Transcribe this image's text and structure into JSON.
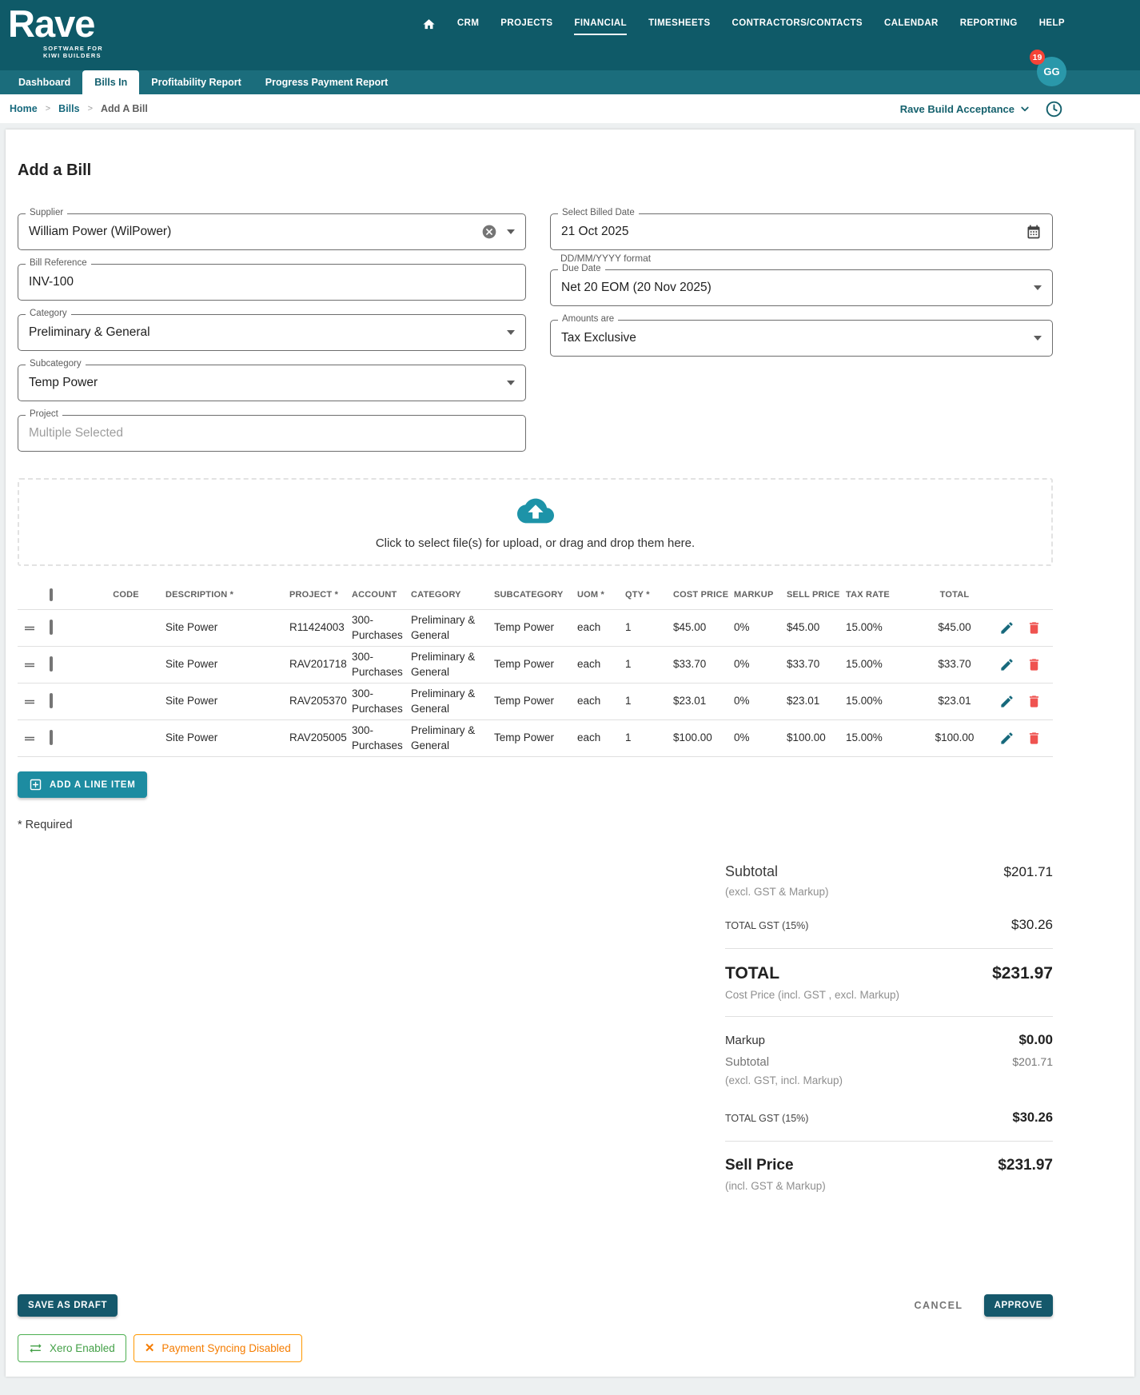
{
  "colors": {
    "header_teal": "#0f5a68",
    "tabrow_teal": "#1b6d7c",
    "accent_teal": "#15616d",
    "bright_teal": "#1d8ca1",
    "button_teal": "#15586b",
    "badge_red": "#f44336",
    "delete_red": "#ef5350",
    "xero_green": "#43a047",
    "warn_orange": "#f57c00"
  },
  "header": {
    "logo_title": "Rave",
    "logo_subtitle_1": "SOFTWARE FOR",
    "logo_subtitle_2": "KIWI BUILDERS",
    "nav": [
      {
        "label": "CRM"
      },
      {
        "label": "PROJECTS"
      },
      {
        "label": "FINANCIAL",
        "active": true
      },
      {
        "label": "TIMESHEETS"
      },
      {
        "label": "CONTRACTORS/CONTACTS"
      },
      {
        "label": "CALENDAR"
      },
      {
        "label": "REPORTING"
      },
      {
        "label": "HELP"
      }
    ],
    "notification_count": "19",
    "avatar_initials": "GG"
  },
  "tabs": [
    {
      "label": "Dashboard"
    },
    {
      "label": "Bills In",
      "active": true
    },
    {
      "label": "Profitability Report"
    },
    {
      "label": "Progress Payment Report"
    }
  ],
  "breadcrumb": {
    "home": "Home",
    "bills": "Bills",
    "current": "Add A Bill"
  },
  "context_bar": {
    "selector_label": "Rave Build Acceptance"
  },
  "page_title": "Add a Bill",
  "form": {
    "supplier": {
      "label": "Supplier",
      "value": "William Power (WilPower)"
    },
    "bill_reference": {
      "label": "Bill Reference",
      "value": "INV-100"
    },
    "category": {
      "label": "Category",
      "value": "Preliminary & General"
    },
    "subcategory": {
      "label": "Subcategory",
      "value": "Temp Power"
    },
    "project": {
      "label": "Project",
      "value": "Multiple Selected"
    },
    "billed_date": {
      "label": "Select Billed Date",
      "value": "21 Oct 2025",
      "helper": "DD/MM/YYYY format"
    },
    "due_date": {
      "label": "Due Date",
      "value": "Net 20 EOM (20 Nov 2025)"
    },
    "amounts_are": {
      "label": "Amounts are",
      "value": "Tax Exclusive"
    }
  },
  "upload_text": "Click to select file(s) for upload, or drag and drop them here.",
  "table": {
    "headers": [
      "CODE",
      "DESCRIPTION *",
      "PROJECT *",
      "ACCOUNT",
      "CATEGORY",
      "SUBCATEGORY",
      "UOM *",
      "QTY *",
      "COST PRICE",
      "MARKUP",
      "SELL PRICE",
      "TAX RATE",
      "TOTAL"
    ],
    "rows": [
      {
        "code": "",
        "description": "Site Power",
        "project": "R11424003",
        "account": "300-Purchases",
        "category": "Preliminary & General",
        "subcategory": "Temp Power",
        "uom": "each",
        "qty": "1",
        "cost_price": "$45.00",
        "markup": "0%",
        "sell_price": "$45.00",
        "tax_rate": "15.00%",
        "total": "$45.00"
      },
      {
        "code": "",
        "description": "Site Power",
        "project": "RAV201718",
        "account": "300-Purchases",
        "category": "Preliminary & General",
        "subcategory": "Temp Power",
        "uom": "each",
        "qty": "1",
        "cost_price": "$33.70",
        "markup": "0%",
        "sell_price": "$33.70",
        "tax_rate": "15.00%",
        "total": "$33.70"
      },
      {
        "code": "",
        "description": "Site Power",
        "project": "RAV205370",
        "account": "300-Purchases",
        "category": "Preliminary & General",
        "subcategory": "Temp Power",
        "uom": "each",
        "qty": "1",
        "cost_price": "$23.01",
        "markup": "0%",
        "sell_price": "$23.01",
        "tax_rate": "15.00%",
        "total": "$23.01"
      },
      {
        "code": "",
        "description": "Site Power",
        "project": "RAV205005",
        "account": "300-Purchases",
        "category": "Preliminary & General",
        "subcategory": "Temp Power",
        "uom": "each",
        "qty": "1",
        "cost_price": "$100.00",
        "markup": "0%",
        "sell_price": "$100.00",
        "tax_rate": "15.00%",
        "total": "$100.00"
      }
    ],
    "add_button_label": "ADD A LINE ITEM",
    "required_note": "* Required"
  },
  "totals": {
    "subtotal_label": "Subtotal",
    "subtotal_value": "$201.71",
    "subtotal_note": "(excl. GST & Markup)",
    "gst1_label": "TOTAL GST (15%)",
    "gst1_value": "$30.26",
    "total_label": "TOTAL",
    "total_value": "$231.97",
    "total_note": "Cost Price (incl. GST , excl. Markup)",
    "markup_label": "Markup",
    "markup_value": "$0.00",
    "subtotal2_label": "Subtotal",
    "subtotal2_value": "$201.71",
    "subtotal2_note": "(excl. GST, incl. Markup)",
    "gst2_label": "TOTAL GST (15%)",
    "gst2_value": "$30.26",
    "sell_label": "Sell Price",
    "sell_value": "$231.97",
    "sell_note": "(incl. GST & Markup)"
  },
  "actions": {
    "save_draft_label": "SAVE AS DRAFT",
    "cancel_label": "CANCEL",
    "approve_label": "APPROVE"
  },
  "status_badges": {
    "xero_label": "Xero Enabled",
    "payment_label": "Payment Syncing Disabled"
  }
}
